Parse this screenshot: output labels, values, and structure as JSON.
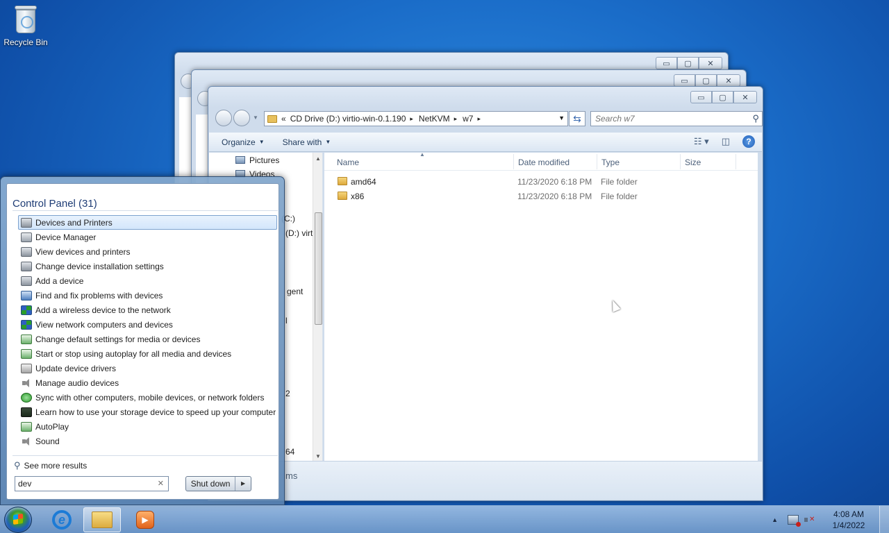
{
  "desktop": {
    "recycle_bin_label": "Recycle Bin"
  },
  "explorer": {
    "caption_buttons": {
      "minimize": "▭",
      "maximize": "▢",
      "close": "✕"
    },
    "address": {
      "overflow": "«",
      "crumbs": [
        "CD Drive (D:) virtio-win-0.1.190",
        "NetKVM",
        "w7"
      ],
      "separator": "▸"
    },
    "search_placeholder": "Search w7",
    "commands": {
      "organize": "Organize",
      "share_with": "Share with"
    },
    "nav_pane": [
      {
        "label": "Pictures",
        "icon": "pictures-icon"
      },
      {
        "label": "Videos",
        "icon": "videos-icon"
      },
      {
        "label": "l (C:)"
      },
      {
        "label": "(D:) virt"
      },
      {
        "label": "gent"
      },
      {
        "label": "l"
      },
      {
        "label": "2"
      },
      {
        "label": "64"
      }
    ],
    "columns": {
      "name": "Name",
      "date_modified": "Date modified",
      "type": "Type",
      "size": "Size"
    },
    "files": [
      {
        "name": "amd64",
        "date_modified": "11/23/2020 6:18 PM",
        "type": "File folder"
      },
      {
        "name": "x86",
        "date_modified": "11/23/2020 6:18 PM",
        "type": "File folder"
      }
    ],
    "details_text": "ms"
  },
  "start_menu": {
    "heading": "Control Panel (31)",
    "results": [
      {
        "label": "Devices and Printers",
        "icon": "printer-icon",
        "selected": true
      },
      {
        "label": "Device Manager",
        "icon": "device-manager-icon"
      },
      {
        "label": "View devices and printers",
        "icon": "printer-icon"
      },
      {
        "label": "Change device installation settings",
        "icon": "printer-icon"
      },
      {
        "label": "Add a device",
        "icon": "printer-icon"
      },
      {
        "label": "Find and fix problems with devices",
        "icon": "troubleshoot-icon"
      },
      {
        "label": "Add a wireless device to the network",
        "icon": "network-icon"
      },
      {
        "label": "View network computers and devices",
        "icon": "network-icon"
      },
      {
        "label": "Change default settings for media or devices",
        "icon": "autoplay-icon"
      },
      {
        "label": "Start or stop using autoplay for all media and devices",
        "icon": "autoplay-icon"
      },
      {
        "label": "Update device drivers",
        "icon": "driver-icon"
      },
      {
        "label": "Manage audio devices",
        "icon": "audio-icon"
      },
      {
        "label": "Sync with other computers, mobile devices, or network folders",
        "icon": "sync-icon"
      },
      {
        "label": "Learn how to use your storage device to speed up your computer",
        "icon": "storage-icon"
      },
      {
        "label": "AutoPlay",
        "icon": "autoplay-icon"
      },
      {
        "label": "Sound",
        "icon": "audio-icon"
      }
    ],
    "see_more": "See more results",
    "search_value": "dev",
    "shutdown_label": "Shut down"
  },
  "taskbar": {
    "time": "4:08 AM",
    "date": "1/4/2022",
    "apps": [
      {
        "name": "internet-explorer-icon"
      },
      {
        "name": "windows-explorer-icon",
        "active": true
      },
      {
        "name": "media-player-icon"
      }
    ]
  }
}
